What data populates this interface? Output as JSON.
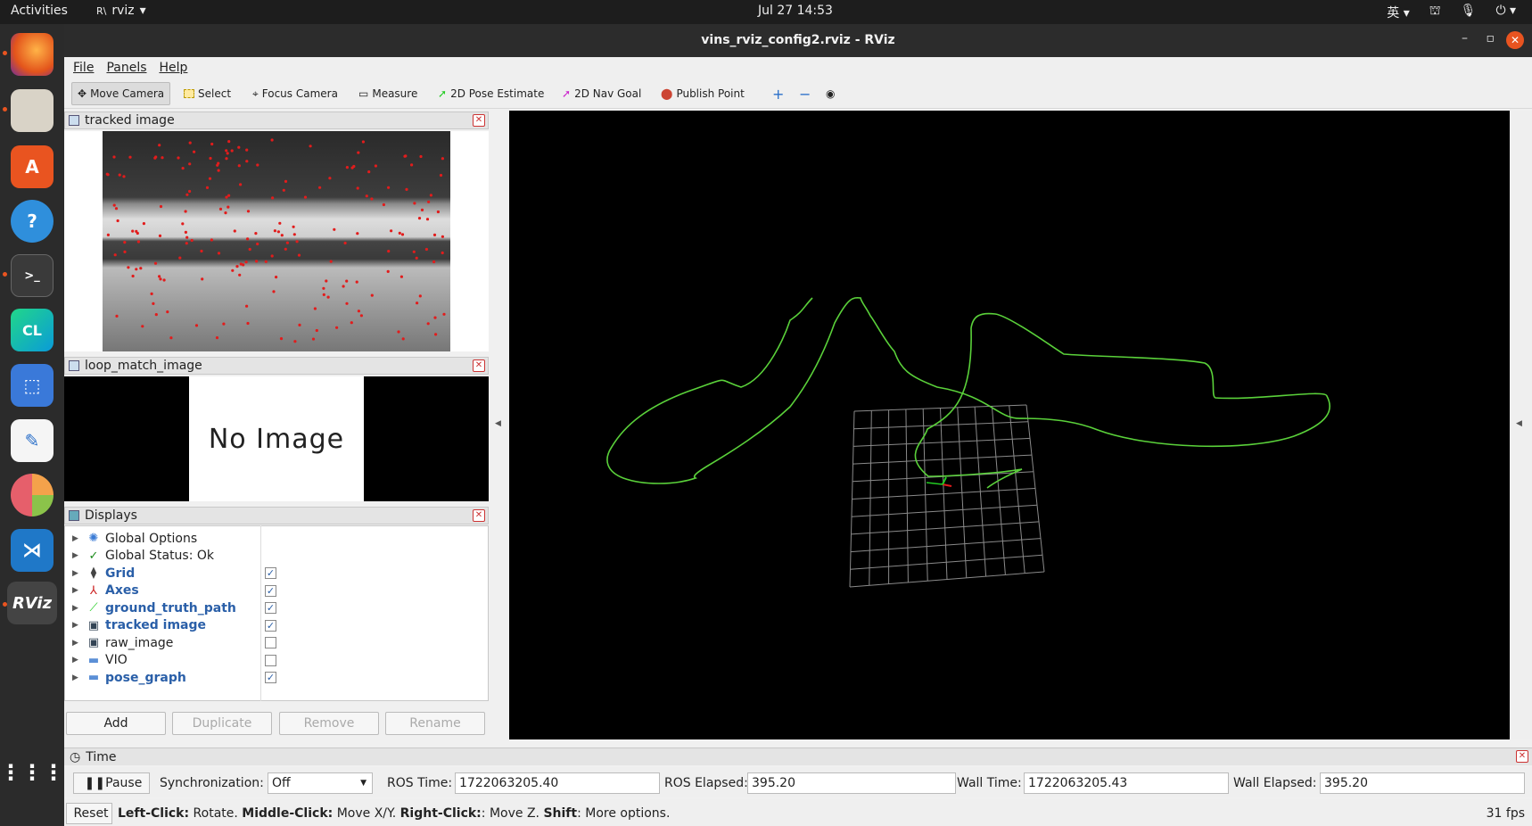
{
  "topbar": {
    "activities": "Activities",
    "app": "rviz",
    "clock": "Jul 27  14:53",
    "ime": "英"
  },
  "window": {
    "title": "vins_rviz_config2.rviz - RViz"
  },
  "menu": [
    "File",
    "Panels",
    "Help"
  ],
  "toolbar": {
    "move_camera": "Move Camera",
    "select": "Select",
    "focus_camera": "Focus Camera",
    "measure": "Measure",
    "pose_estimate": "2D Pose Estimate",
    "nav_goal": "2D Nav Goal",
    "publish_point": "Publish Point"
  },
  "panels": {
    "tracked_image": "tracked image",
    "loop_match_image": "loop_match_image",
    "no_image": "No Image",
    "displays": "Displays"
  },
  "displays": [
    {
      "label": "Global Options",
      "icon": "gear-icon",
      "bold": false,
      "checked": null
    },
    {
      "label": "Global Status: Ok",
      "icon": "check-icon",
      "bold": false,
      "checked": null
    },
    {
      "label": "Grid",
      "icon": "grid-icon",
      "bold": true,
      "checked": true
    },
    {
      "label": "Axes",
      "icon": "axes-icon",
      "bold": true,
      "checked": true
    },
    {
      "label": "ground_truth_path",
      "icon": "path-icon",
      "bold": true,
      "checked": true
    },
    {
      "label": "tracked image",
      "icon": "image-icon",
      "bold": true,
      "checked": true
    },
    {
      "label": "raw_image",
      "icon": "image-icon",
      "bold": false,
      "checked": false
    },
    {
      "label": "VIO",
      "icon": "folder-icon",
      "bold": false,
      "checked": false
    },
    {
      "label": "pose_graph",
      "icon": "folder-icon",
      "bold": true,
      "checked": true
    }
  ],
  "display_buttons": {
    "add": "Add",
    "duplicate": "Duplicate",
    "remove": "Remove",
    "rename": "Rename"
  },
  "time": {
    "title": "Time",
    "pause": "Pause",
    "sync_label": "Synchronization:",
    "sync_value": "Off",
    "ros_time_label": "ROS Time:",
    "ros_time": "1722063205.40",
    "ros_elapsed_label": "ROS Elapsed:",
    "ros_elapsed": "395.20",
    "wall_time_label": "Wall Time:",
    "wall_time": "1722063205.43",
    "wall_elapsed_label": "Wall Elapsed:",
    "wall_elapsed": "395.20"
  },
  "status": {
    "reset": "Reset",
    "left_click": "Left-Click:",
    "left_click_action": " Rotate. ",
    "middle_click": "Middle-Click:",
    "middle_click_action": " Move X/Y. ",
    "right_click": "Right-Click:",
    "right_click_action": ": Move Z. ",
    "shift": "Shift",
    "shift_action": ": More options.",
    "fps": "31 fps"
  },
  "colors": {
    "path": "#5ad13a",
    "accent": "#e95420"
  }
}
